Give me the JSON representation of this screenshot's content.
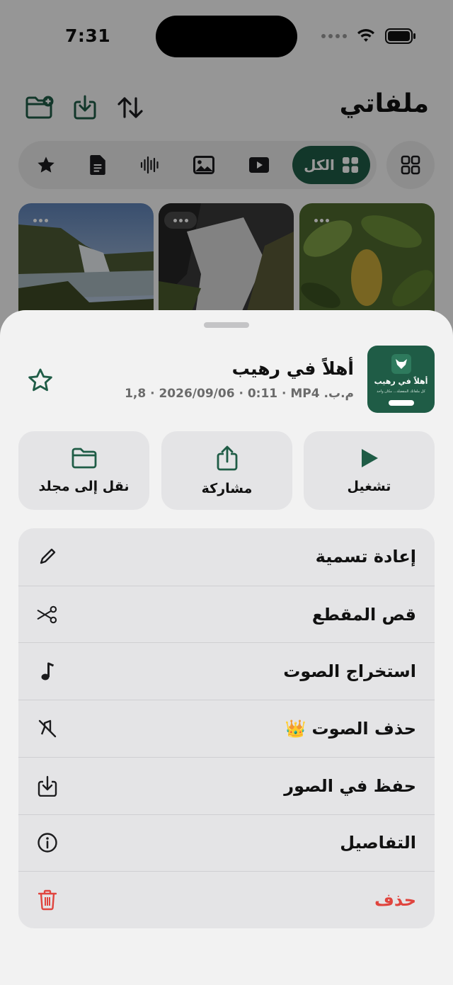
{
  "status_bar": {
    "time": "7:31"
  },
  "header": {
    "title": "ملفاتي"
  },
  "filters": {
    "all_label": "الكل",
    "items": [
      "favorites-icon",
      "documents-icon",
      "audio-icon",
      "images-icon",
      "videos-icon"
    ]
  },
  "sheet": {
    "file": {
      "title": "أهلاً في رهيب",
      "meta": "م.ب. ‎1,8 · 2026/09/06 · 0:11 · MP4",
      "thumb_title": "أهلاً في رهيب",
      "thumb_subtitle": "كل ملفاتك المفضلة… مكان واحد"
    },
    "quick_actions": {
      "play": "تشغيل",
      "share": "مشاركة",
      "move": "نقل إلى مجلد"
    },
    "menu": {
      "rename": "إعادة تسمية",
      "trim": "قص المقطع",
      "extract_audio": "استخراج الصوت",
      "remove_audio": "حذف الصوت",
      "premium_badge": "👑",
      "save_to_photos": "حفظ في الصور",
      "details": "التفاصيل",
      "delete": "حذف"
    }
  },
  "colors": {
    "accent": "#1f5c46",
    "danger": "#e0443e",
    "sheet_bg": "#f2f2f2",
    "card_bg": "#e4e4e6"
  }
}
